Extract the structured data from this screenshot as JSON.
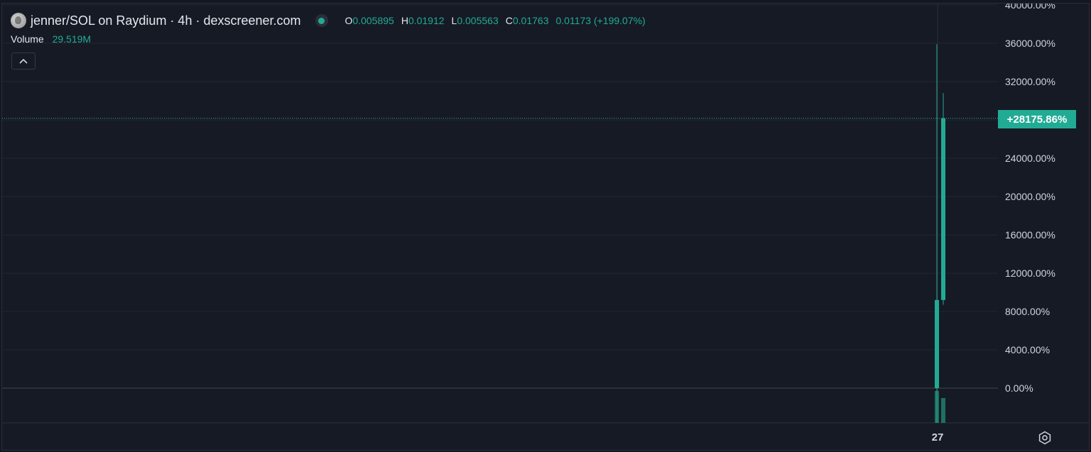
{
  "header": {
    "pair_title": "jenner/SOL on Raydium · 4h · dexscreener.com",
    "ohlc": {
      "o_label": "O",
      "o_value": "0.005895",
      "h_label": "H",
      "h_value": "0.01912",
      "l_label": "L",
      "l_value": "0.005563",
      "c_label": "C",
      "c_value": "0.01763",
      "change": "0.01173 (+199.07%)"
    },
    "volume_label": "Volume",
    "volume_value": "29.519M"
  },
  "icons": {
    "pair": "token-avatar-icon",
    "status": "live-status-dot-icon",
    "collapse": "chevron-up-icon",
    "settings": "gear-icon"
  },
  "colors": {
    "background": "#161a25",
    "grid": "#222631",
    "up": "#22ab94",
    "volume": "#1f6f62",
    "axis_text": "#d1d4dc",
    "zero_line": "#434651"
  },
  "price_badge": "+28175.86%",
  "chart_data": {
    "type": "candlestick",
    "y_scale": "percent",
    "ylim": [
      -4000,
      40000
    ],
    "y_ticks": [
      0,
      4000,
      8000,
      12000,
      16000,
      20000,
      24000,
      28000,
      32000,
      36000,
      40000
    ],
    "y_tick_labels": [
      "0.00%",
      "4000.00%",
      "8000.00%",
      "12000.00%",
      "16000.00%",
      "20000.00%",
      "24000.00%",
      "",
      "32000.00%",
      "36000.00%",
      "40000.00%"
    ],
    "x_tick_labels": [
      "27"
    ],
    "last_value_pct": 28175.86,
    "candles": [
      {
        "open": 0,
        "high": 35900,
        "low": -4000,
        "close": 9200
      },
      {
        "open": 9200,
        "high": 30800,
        "low": 8700,
        "close": 28175.86
      }
    ],
    "volume": [
      {
        "value": 1.0
      },
      {
        "value": 0.78
      }
    ]
  }
}
